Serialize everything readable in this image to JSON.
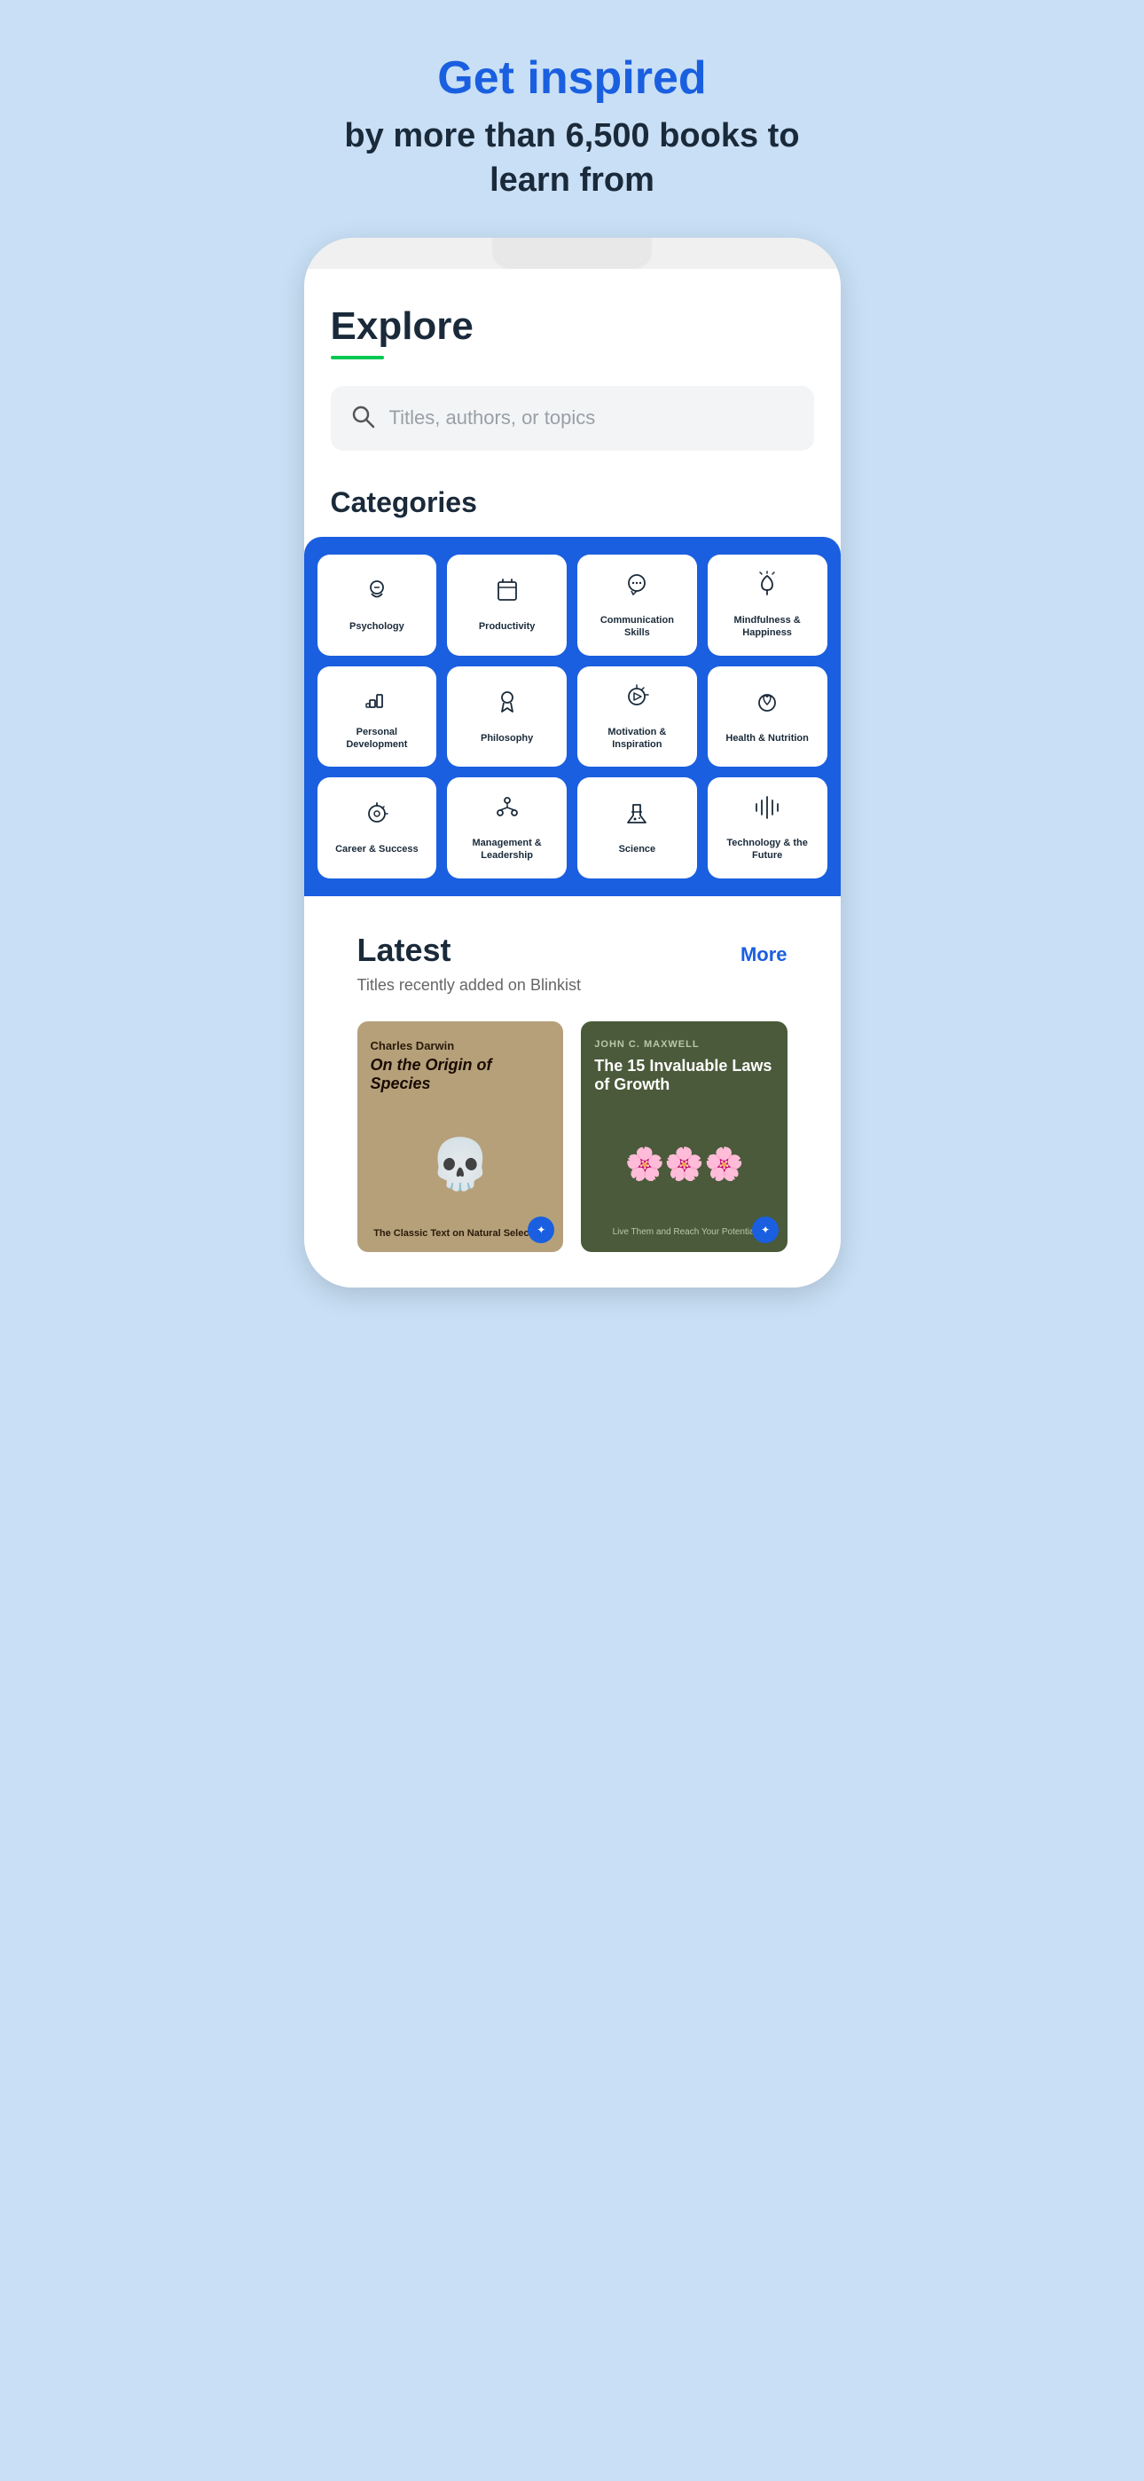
{
  "hero": {
    "title": "Get inspired",
    "subtitle": "by more than 6,500 books to learn from"
  },
  "explore": {
    "title": "Explore",
    "underline_color": "#00c853"
  },
  "search": {
    "placeholder": "Titles, authors, or topics"
  },
  "categories": {
    "title": "Categories",
    "items": [
      {
        "id": "psychology",
        "label": "Psychology",
        "icon": "psychology"
      },
      {
        "id": "productivity",
        "label": "Productivity",
        "icon": "productivity"
      },
      {
        "id": "communication",
        "label": "Communication Skills",
        "icon": "communication"
      },
      {
        "id": "mindfulness",
        "label": "Mindfulness & Happiness",
        "icon": "mindfulness"
      },
      {
        "id": "personal-dev",
        "label": "Personal Development",
        "icon": "personal-dev"
      },
      {
        "id": "philosophy",
        "label": "Philosophy",
        "icon": "philosophy"
      },
      {
        "id": "motivation",
        "label": "Motivation & Inspiration",
        "icon": "motivation"
      },
      {
        "id": "health",
        "label": "Health & Nutrition",
        "icon": "health"
      },
      {
        "id": "career",
        "label": "Career & Success",
        "icon": "career"
      },
      {
        "id": "management",
        "label": "Management & Leadership",
        "icon": "management"
      },
      {
        "id": "science",
        "label": "Science",
        "icon": "science"
      },
      {
        "id": "technology",
        "label": "Technology & the Future",
        "icon": "technology"
      }
    ]
  },
  "latest": {
    "title": "Latest",
    "subtitle": "Titles recently added on Blinkist",
    "more_label": "More",
    "books": [
      {
        "id": "darwin",
        "author": "Charles Darwin",
        "title": "On the Origin of Species",
        "subtitle": "The Classic Text on Natural Selection",
        "bg_color": "#b5a07a"
      },
      {
        "id": "maxwell",
        "author": "JOHN C. MAXWELL",
        "title": "The 15 Invaluable Laws of Growth",
        "subtitle": "Live Them and Reach Your Potential",
        "bg_color": "#4a5a3a"
      }
    ]
  }
}
